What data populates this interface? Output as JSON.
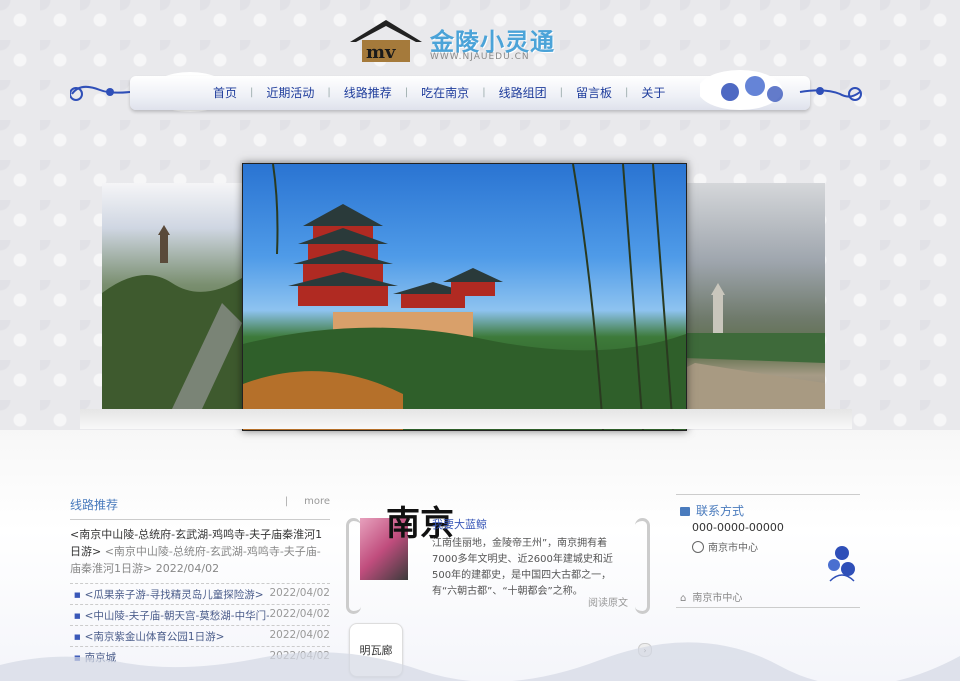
{
  "logo": {
    "title": "金陵小灵通",
    "subtitle": "WWW.NJAUEDU.CN",
    "badge": "mv"
  },
  "nav": {
    "items": [
      "首页",
      "近期活动",
      "线路推荐",
      "吃在南京",
      "线路组团",
      "留言板",
      "关于"
    ]
  },
  "banner": {
    "left_alt": "",
    "main_alt": "",
    "right_alt": ""
  },
  "news": {
    "title": "线路推荐",
    "more": "more",
    "featured": {
      "title": "<南京中山陵-总统府-玄武湖-鸡鸣寺-夫子庙秦淮河1日游>",
      "highlight": "<南京中山陵-总统府-玄武湖-鸡鸣寺-夫子庙-庙秦淮河1日游>",
      "date": "2022/04/02"
    },
    "items": [
      {
        "title": "<瓜果亲子游-寻找精灵岛儿童探险游>",
        "date": "2022/04/02"
      },
      {
        "title": "<中山陵-夫子庙-朝天宫-莫愁湖-中华门-阅江…",
        "date": "2022/04/02"
      },
      {
        "title": "<南京紫金山体育公园1日游>",
        "date": "2022/04/02"
      },
      {
        "title": "南京城",
        "date": "2022/04/02"
      }
    ]
  },
  "card": {
    "calligraphy": "南京",
    "heading": "我要大蓝鲸",
    "text": "江南佳丽地，金陵帝王州”，南京拥有着7000多年文明史、近2600年建城史和近500年的建都史，是中国四大古都之一，有“六朝古都”、“十朝都会”之称。",
    "more": "阅读原文"
  },
  "thumb": {
    "label": "明瓦廊"
  },
  "contact": {
    "title": "联系方式",
    "phone": "000-0000-00000",
    "address": "南京市中心",
    "footer": "南京市中心"
  },
  "colors": {
    "accent": "#4a7bbd",
    "nav": "#1f3d9c",
    "porcelain": "#2f4fb8"
  }
}
